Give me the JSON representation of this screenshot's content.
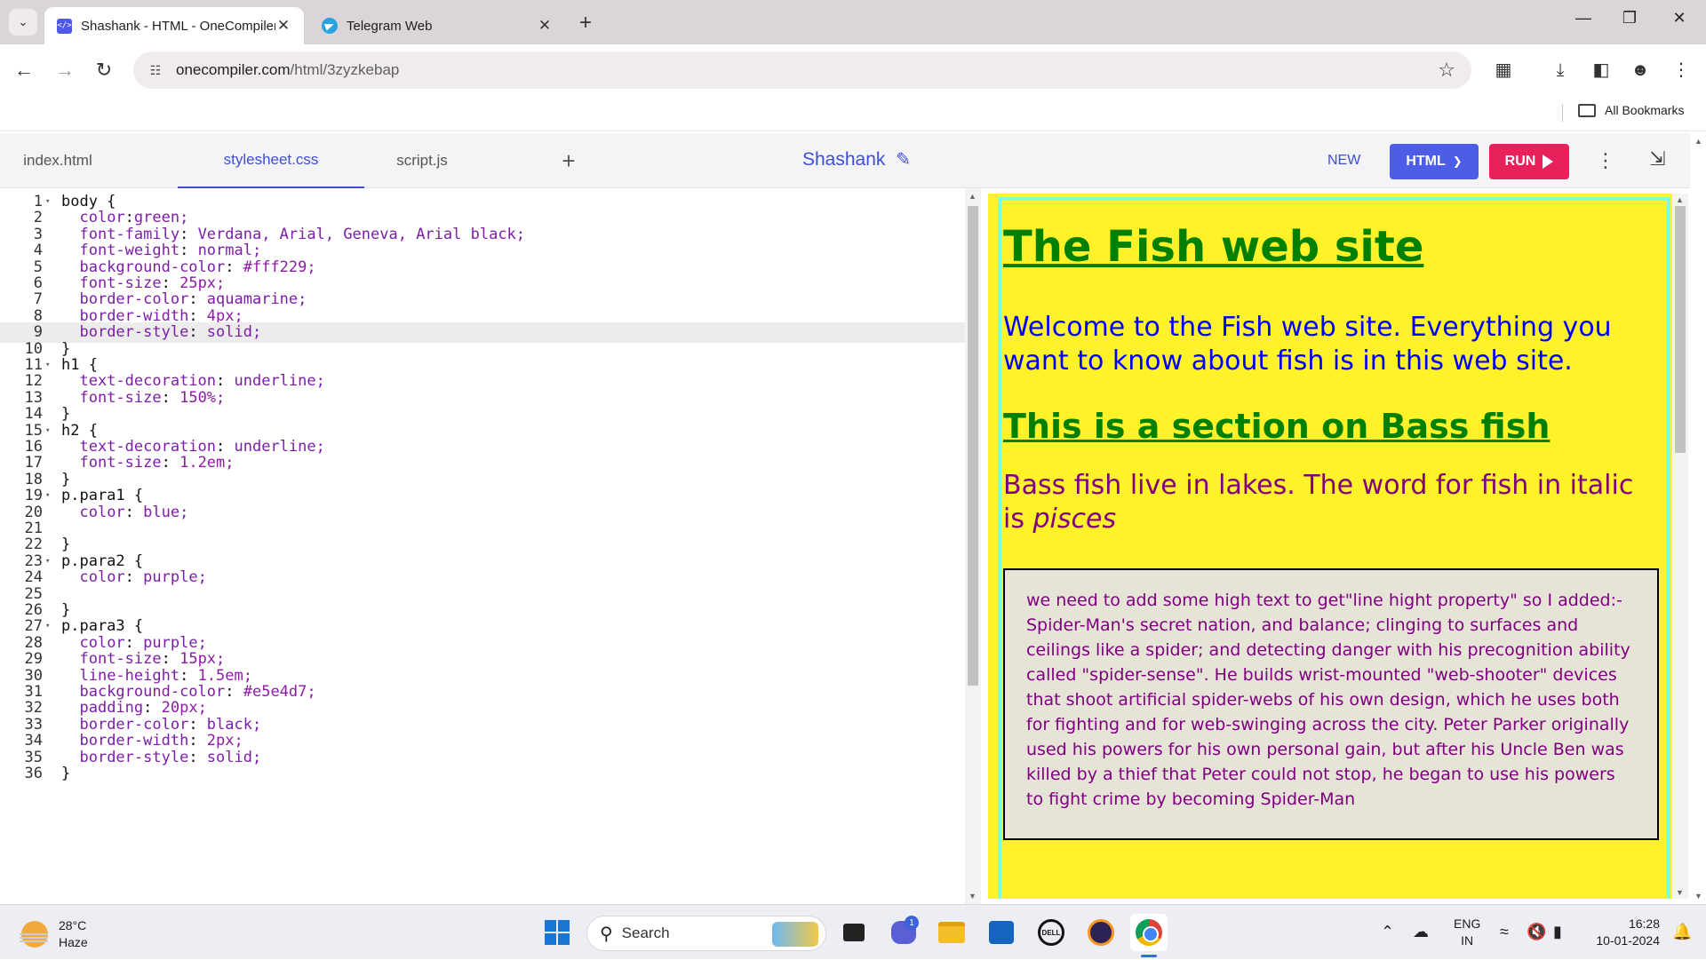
{
  "browser": {
    "tabs": [
      {
        "title": "Shashank - HTML - OneCompiler",
        "favicon": "code-icon",
        "active": true
      },
      {
        "title": "Telegram Web",
        "favicon": "telegram-icon",
        "active": false
      }
    ],
    "url_host": "onecompiler.com",
    "url_path": "/html/3zyzkebap",
    "bookmarks_label": "All Bookmarks"
  },
  "app": {
    "file_tabs": [
      {
        "label": "index.html"
      },
      {
        "label": "stylesheet.css"
      },
      {
        "label": "script.js"
      }
    ],
    "active_file": "stylesheet.css",
    "project_name": "Shashank",
    "new_label": "NEW",
    "language_label": "HTML",
    "run_label": "RUN",
    "accent_color": "#3d4ed8",
    "run_color": "#e8215d"
  },
  "editor": {
    "active_line": 9,
    "lines": [
      "body {",
      "  color:green;",
      "  font-family: Verdana, Arial, Geneva, Arial black;",
      "  font-weight: normal;",
      "  background-color: #fff229;",
      "  font-size: 25px;",
      "  border-color: aquamarine;",
      "  border-width: 4px;",
      "  border-style: solid;",
      "}",
      "h1 {",
      "  text-decoration: underline;",
      "  font-size: 150%;",
      "}",
      "h2 {",
      "  text-decoration: underline;",
      "  font-size: 1.2em;",
      "}",
      "p.para1 {",
      "  color: blue;",
      "",
      "}",
      "p.para2 {",
      "  color: purple;",
      "",
      "}",
      "p.para3 {",
      "  color: purple;",
      "  font-size: 15px;",
      "  line-height: 1.5em;",
      "  background-color: #e5e4d7;",
      "  padding: 20px;",
      "  border-color: black;",
      "  border-width: 2px;",
      "  border-style: solid;",
      "}"
    ],
    "fold_lines": [
      1,
      11,
      15,
      19,
      23,
      27
    ]
  },
  "preview": {
    "h1": "The Fish web site",
    "para1": "Welcome to the Fish web site. Everything you want to know about fish is in this web site.",
    "h2": "This is a section on Bass fish",
    "para2_text": "Bass fish live in lakes. The word for fish in italic is ",
    "para2_italic": "pisces",
    "para3": "we need to add some high text to get\"line hight property\" so I added:- Spider-Man's secret nation, and balance; clinging to surfaces and ceilings like a spider; and detecting danger with his precognition ability called \"spider-sense\". He builds wrist-mounted \"web-shooter\" devices that shoot artificial spider-webs of his own design, which he uses both for fighting and for web-swinging across the city. Peter Parker originally used his powers for his own personal gain, but after his Uncle Ben was killed by a thief that Peter could not stop, he began to use his powers to fight crime by becoming Spider-Man",
    "body_bg": "#fff229",
    "para3_bg": "#e5e4d7"
  },
  "taskbar": {
    "weather_temp": "28°C",
    "weather_desc": "Haze",
    "search_label": "Search",
    "chat_badge": "1",
    "lang_top": "ENG",
    "lang_bottom": "IN",
    "time": "16:28",
    "date": "10-01-2024"
  }
}
